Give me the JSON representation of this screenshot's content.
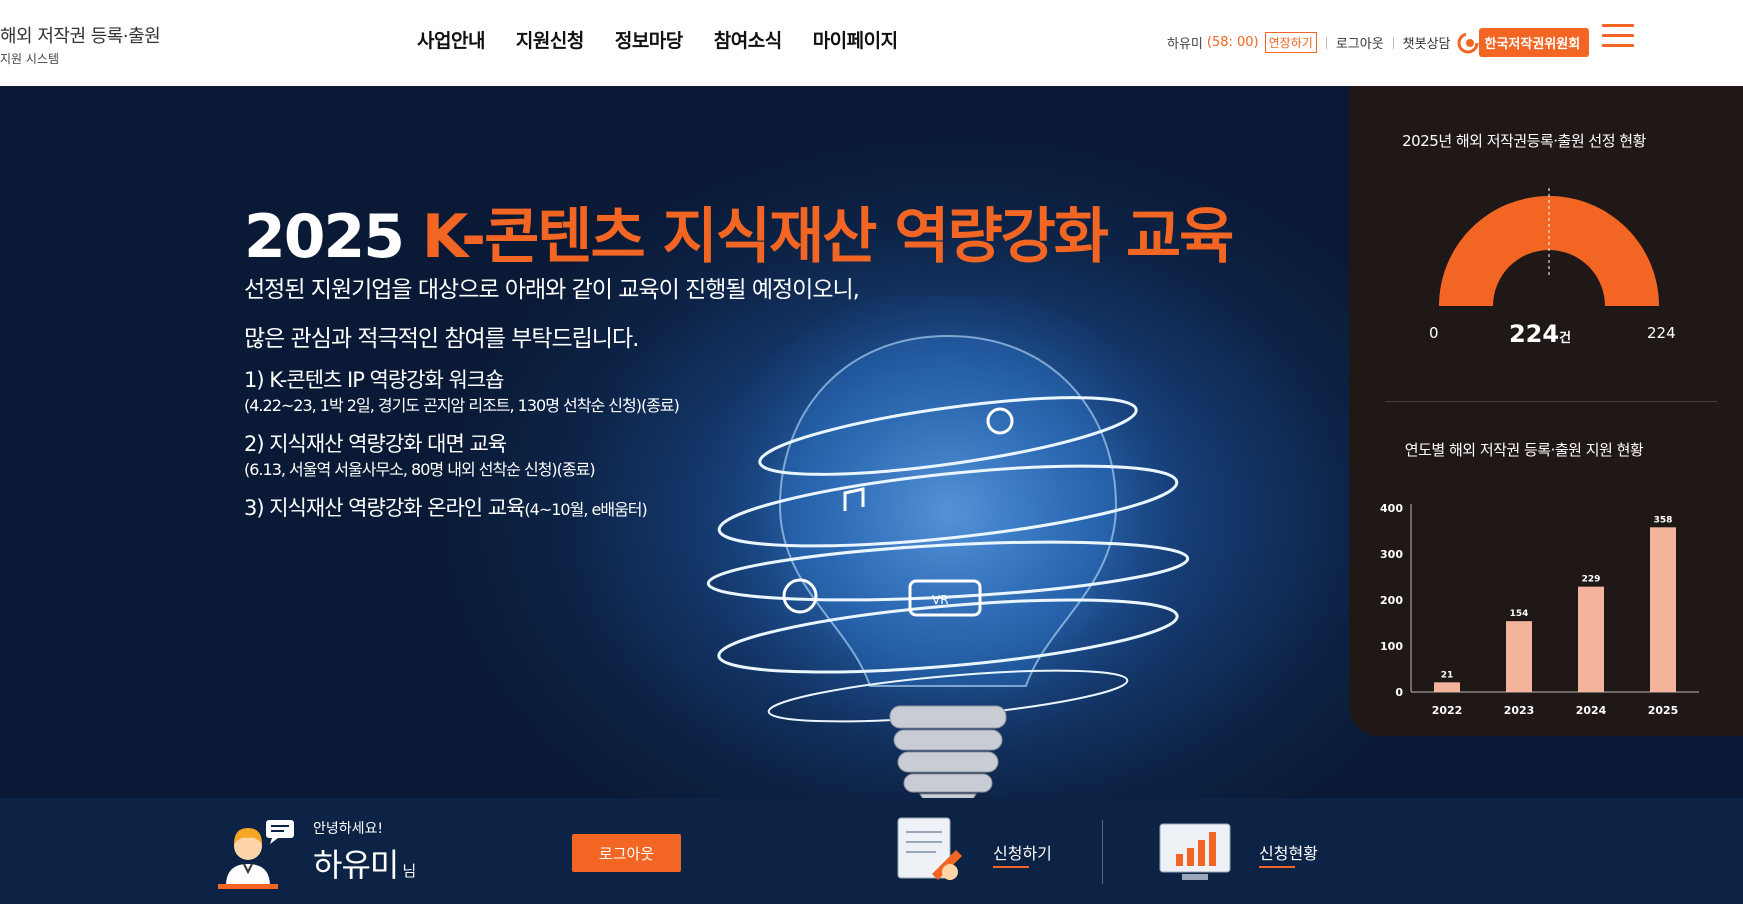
{
  "header": {
    "logo_main": "해외 저작권 등록·출원",
    "logo_sub": "지원 시스템",
    "nav": [
      "사업안내",
      "지원신청",
      "정보마당",
      "참여소식",
      "마이페이지"
    ],
    "user_name": "하유미",
    "session_timer": "(58: 00)",
    "extend_label": "연장하기",
    "logout_label": "로그아웃",
    "chatbot_label": "챗봇상담",
    "org_label": "한국저작권위원회"
  },
  "hero": {
    "title_year": "2025",
    "title_accent": "K-콘텐츠 지식재산 역량강화 교육",
    "desc_line1": "선정된 지원기업을 대상으로 아래와 같이 교육이 진행될 예정이오니,",
    "desc_line2": "많은 관심과 적극적인 참여를 부탁드립니다.",
    "item1": "1) K-콘텐츠 IP 역량강화 워크숍",
    "item1_sub": "(4.22~23, 1박 2일, 경기도 곤지암 리조트, 130명 선착순 신청)(종료)",
    "item2": "2) 지식재산 역량강화 대면 교육",
    "item2_sub": "(6.13, 서울역 서울사무소, 80명 내외 선착순 신청)(종료)",
    "item3_main": "3) 지식재산 역량강화 온라인 교육",
    "item3_suffix": "(4~10월, e배움터)"
  },
  "status_panel": {
    "gauge_title": "2025년 해외 저작권등록·출원 선정 현황",
    "gauge_min": "0",
    "gauge_max": "224",
    "gauge_value": "224",
    "gauge_unit": "건",
    "gauge_fraction": 1.0,
    "bar_title": "연도별 해외 저작권 등록·출원 지원 현황"
  },
  "chart_data": {
    "type": "bar",
    "categories": [
      "2022",
      "2023",
      "2024",
      "2025"
    ],
    "values": [
      21,
      154,
      229,
      358
    ],
    "ylim": [
      0,
      400
    ],
    "yticks": [
      0,
      100,
      200,
      300,
      400
    ],
    "title": "연도별 해외 저작권 등록·출원 지원 현황",
    "bar_color": "#f4b49c"
  },
  "bottom": {
    "greeting": "안녕하세요!",
    "user_name": "하유미",
    "honorific": "님",
    "logout_label": "로그아웃",
    "quick_apply": "신청하기",
    "quick_status": "신청현황"
  },
  "colors": {
    "accent": "#f26522",
    "panel_bg": "#201816",
    "bottom_bg": "#0d2345"
  }
}
